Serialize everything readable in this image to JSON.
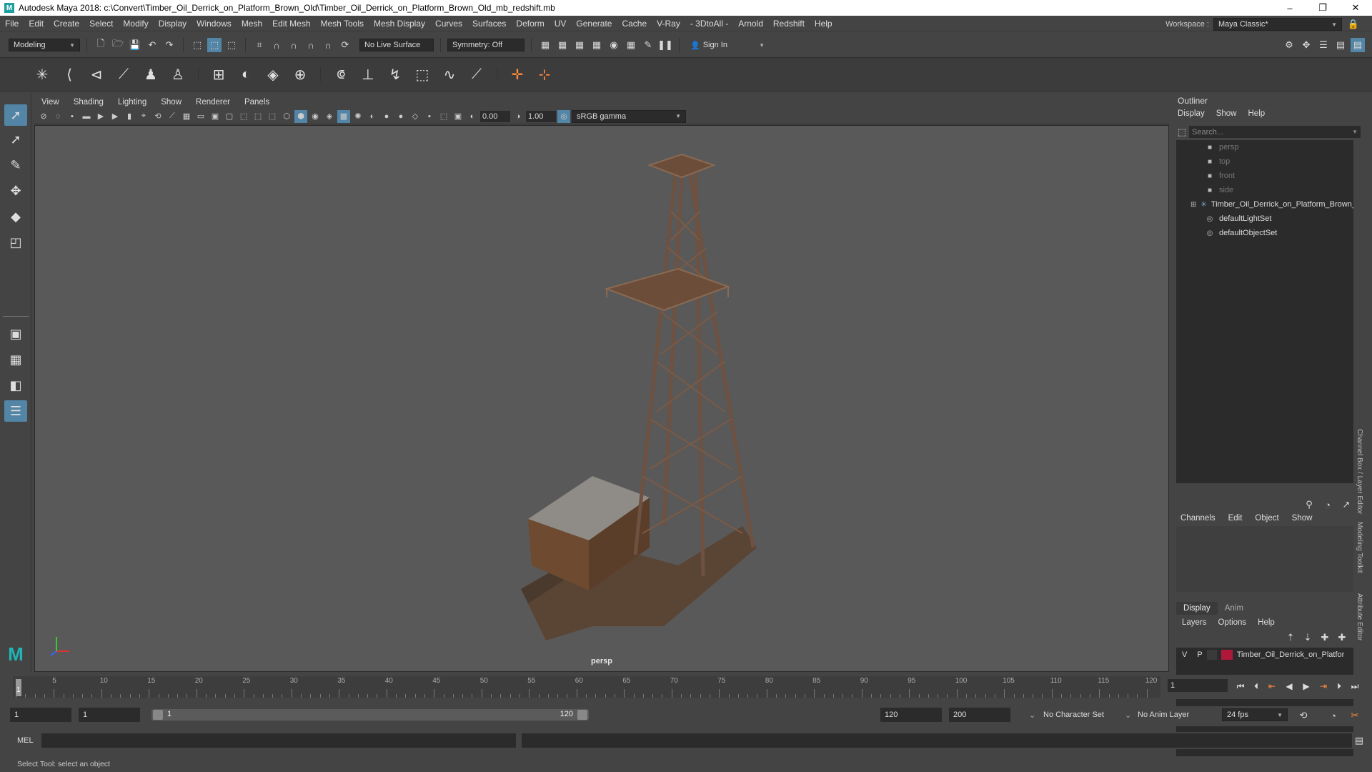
{
  "window": {
    "title": "Autodesk Maya 2018: c:\\Convert\\Timber_Oil_Derrick_on_Platform_Brown_Old\\Timber_Oil_Derrick_on_Platform_Brown_Old_mb_redshift.mb",
    "minimize": "–",
    "maximize": "❐",
    "close": "✕"
  },
  "menubar": {
    "items": [
      "File",
      "Edit",
      "Create",
      "Select",
      "Modify",
      "Display",
      "Windows",
      "Mesh",
      "Edit Mesh",
      "Mesh Tools",
      "Mesh Display",
      "Curves",
      "Surfaces",
      "Deform",
      "UV",
      "Generate",
      "Cache",
      "V-Ray",
      "- 3DtoAll -",
      "Arnold",
      "Redshift",
      "Help"
    ],
    "workspace_label": "Workspace :",
    "workspace_value": "Maya Classic*"
  },
  "statusline": {
    "mode": "Modeling",
    "live_surface": "No Live Surface",
    "symmetry": "Symmetry: Off",
    "sign_in": "Sign In"
  },
  "panel": {
    "menus": [
      "View",
      "Shading",
      "Lighting",
      "Show",
      "Renderer",
      "Panels"
    ],
    "exposure": "0.00",
    "gamma": "1.00",
    "color_space": "sRGB gamma",
    "camera": "persp"
  },
  "outliner": {
    "title": "Outliner",
    "menus": [
      "Display",
      "Show",
      "Help"
    ],
    "search_placeholder": "Search...",
    "items": [
      {
        "label": "persp",
        "icon": "camera-icon",
        "dim": true
      },
      {
        "label": "top",
        "icon": "camera-icon",
        "dim": true
      },
      {
        "label": "front",
        "icon": "camera-icon",
        "dim": true
      },
      {
        "label": "side",
        "icon": "camera-icon",
        "dim": true
      },
      {
        "label": "Timber_Oil_Derrick_on_Platform_Brown_",
        "icon": "group-icon",
        "dim": false
      },
      {
        "label": "defaultLightSet",
        "icon": "set-icon",
        "dim": false
      },
      {
        "label": "defaultObjectSet",
        "icon": "set-icon",
        "dim": false
      }
    ]
  },
  "channelbox": {
    "menus": [
      "Channels",
      "Edit",
      "Object",
      "Show"
    ],
    "side_tab": "Channel Box / Layer Editor"
  },
  "layers": {
    "tabs": [
      "Display",
      "Anim"
    ],
    "menus": [
      "Layers",
      "Options",
      "Help"
    ],
    "rows": [
      {
        "v": "V",
        "p": "P",
        "name": "Timber_Oil_Derrick_on_Platfor",
        "color": "#b0183a"
      }
    ],
    "side_tab_1": "Modeling Toolkit",
    "side_tab_2": "Attribute Editor"
  },
  "timeline": {
    "tick_labels": [
      "5",
      "10",
      "15",
      "20",
      "25",
      "30",
      "35",
      "40",
      "45",
      "50",
      "55",
      "60",
      "65",
      "70",
      "75",
      "80",
      "85",
      "90",
      "95",
      "100",
      "105",
      "110",
      "115",
      "120"
    ],
    "start_marker": "1",
    "current_frame": "1"
  },
  "range": {
    "start": "1",
    "playback_start": "1",
    "slider_start": "1",
    "slider_end": "120",
    "playback_end": "120",
    "end": "200",
    "character_set": "No Character Set",
    "anim_layer": "No Anim Layer",
    "fps": "24 fps"
  },
  "commandline": {
    "label": "MEL"
  },
  "helpline": {
    "text": "Select Tool: select an object"
  }
}
